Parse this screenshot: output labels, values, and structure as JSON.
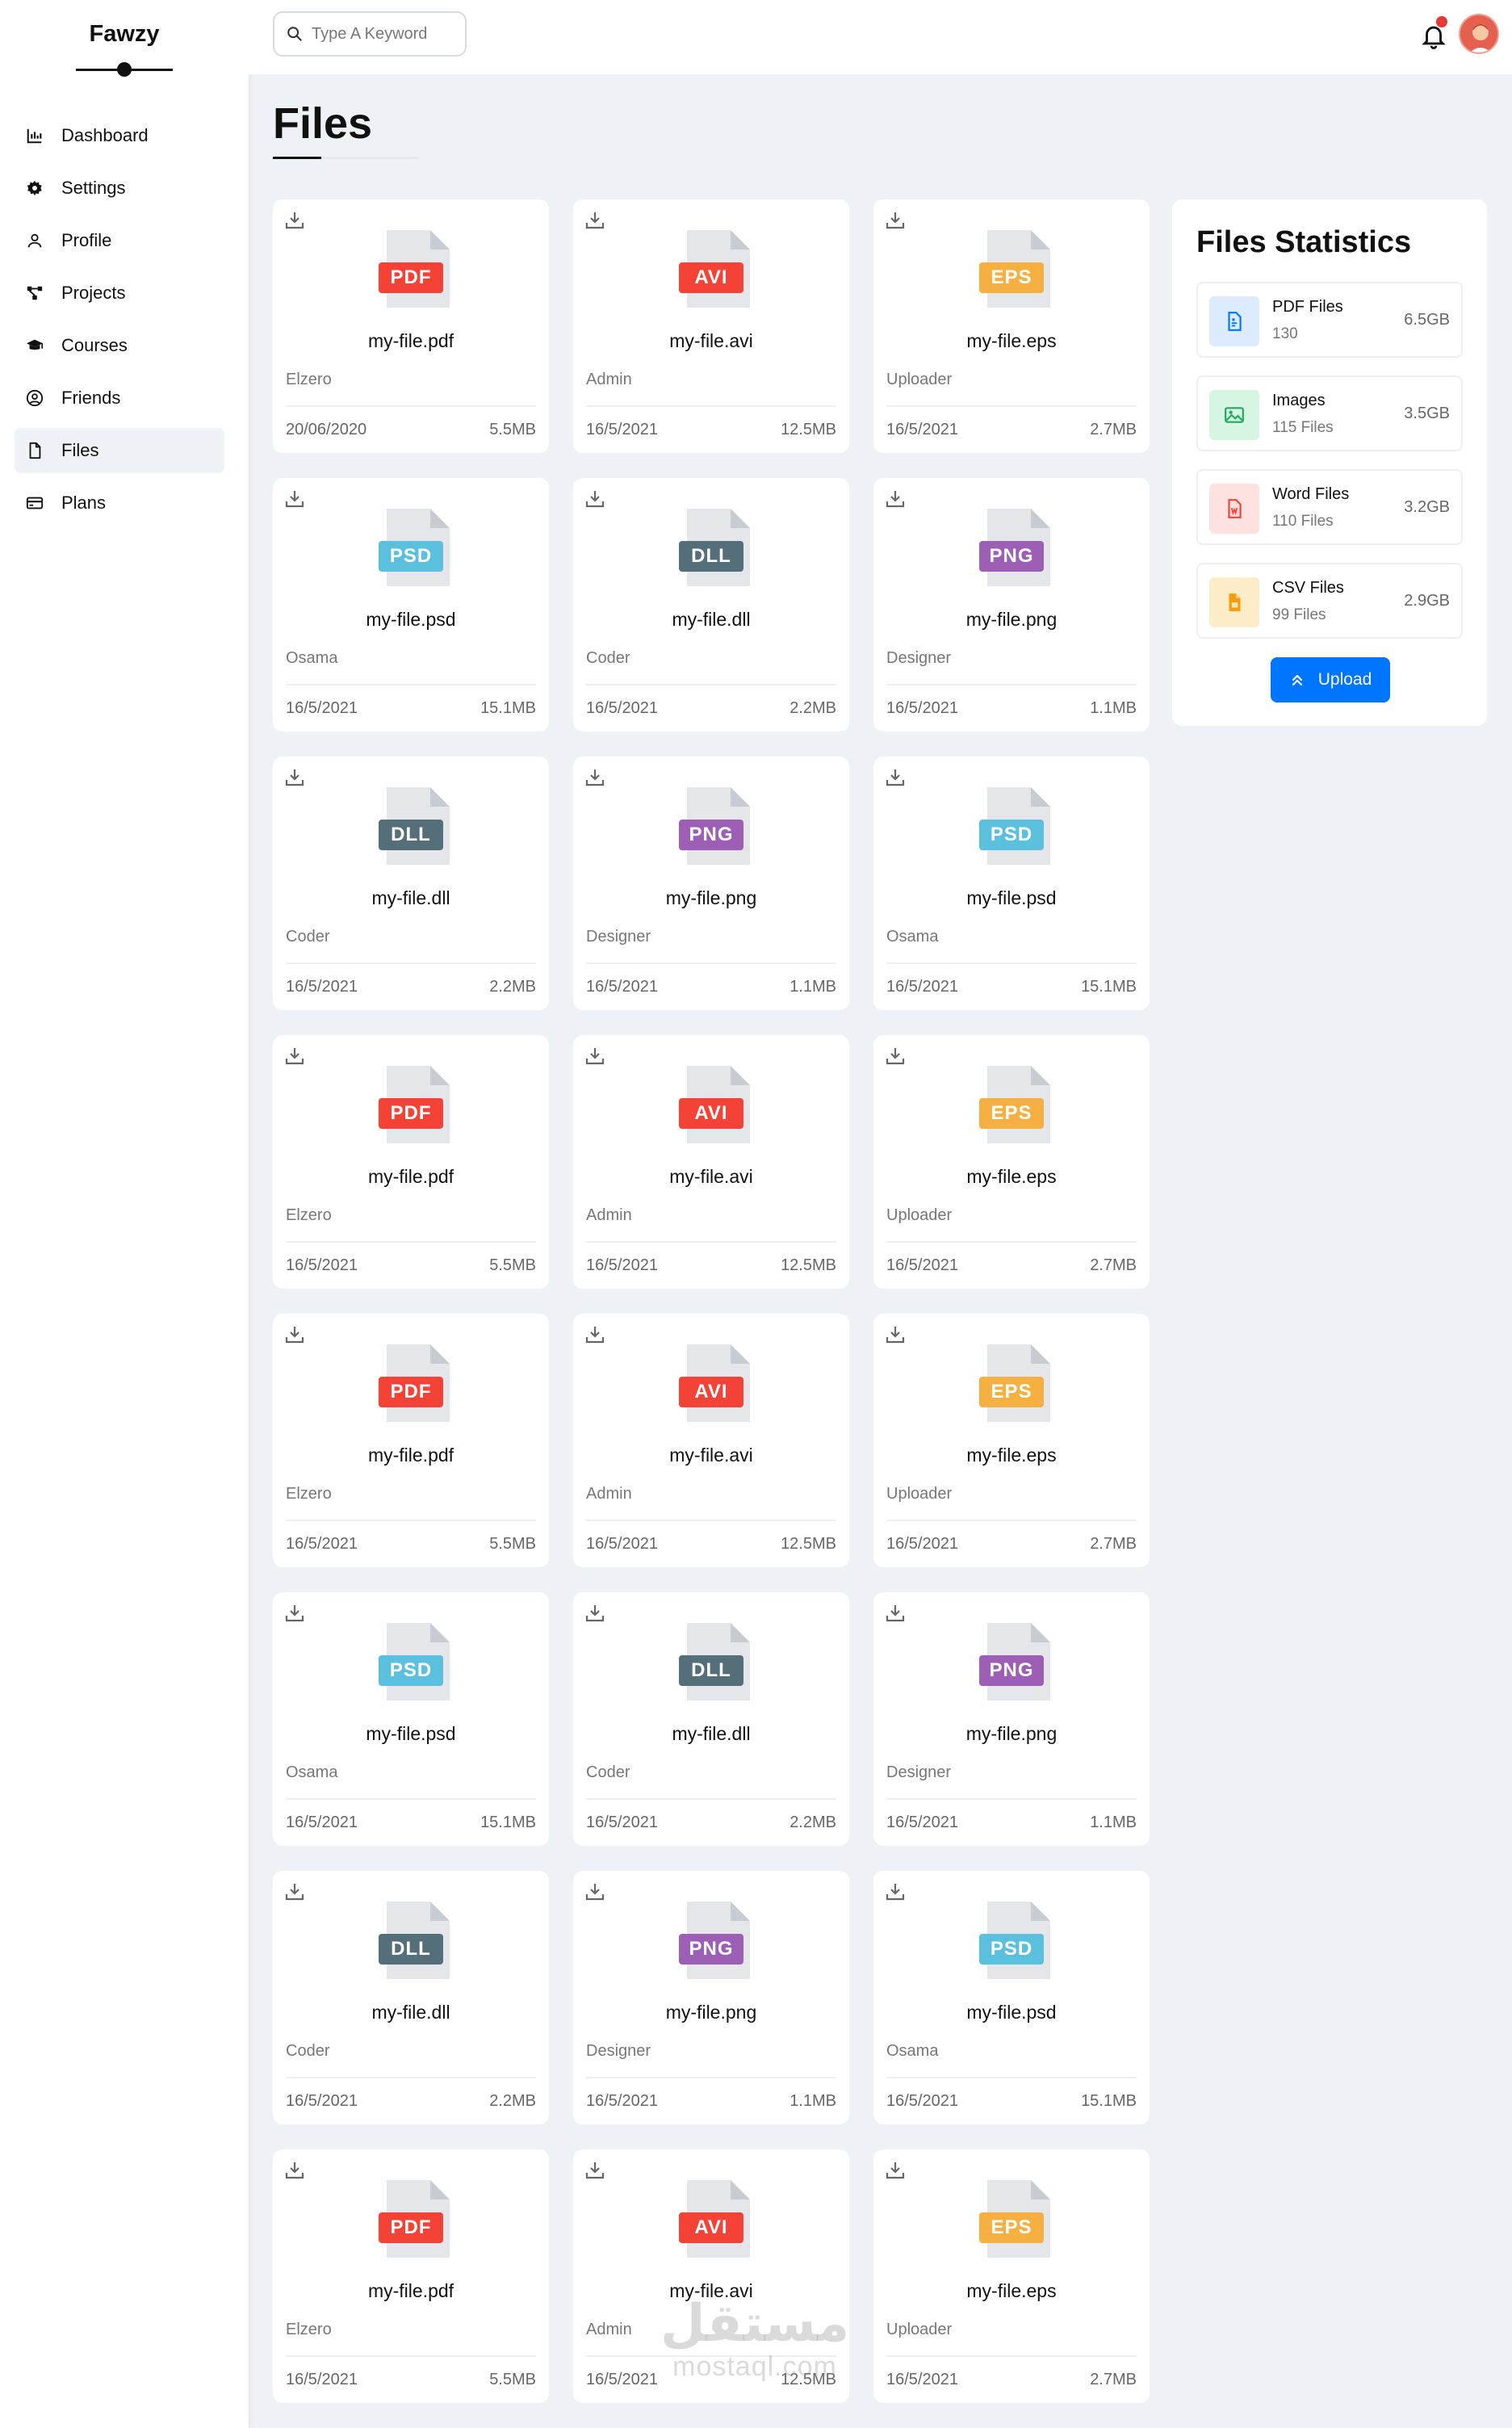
{
  "brand": "Fawzy",
  "nav": [
    {
      "label": "Dashboard",
      "icon": "chart-icon",
      "key": "dashboard"
    },
    {
      "label": "Settings",
      "icon": "gear-icon",
      "key": "settings"
    },
    {
      "label": "Profile",
      "icon": "user-icon",
      "key": "profile"
    },
    {
      "label": "Projects",
      "icon": "diagram-icon",
      "key": "projects"
    },
    {
      "label": "Courses",
      "icon": "graduation-cap-icon",
      "key": "courses"
    },
    {
      "label": "Friends",
      "icon": "user-circle-icon",
      "key": "friends"
    },
    {
      "label": "Files",
      "icon": "file-icon",
      "key": "files",
      "active": true
    },
    {
      "label": "Plans",
      "icon": "credit-card-icon",
      "key": "plans"
    }
  ],
  "search": {
    "placeholder": "Type A Keyword"
  },
  "page_title": "Files",
  "ext_colors": {
    "PDF": "#f44336",
    "AVI": "#f44336",
    "EPS": "#f5b041",
    "PSD": "#5bc0de",
    "DLL": "#546e7a",
    "PNG": "#9c5fb5"
  },
  "files": [
    {
      "ext": "PDF",
      "name": "my-file.pdf",
      "uploader": "Elzero",
      "date": "20/06/2020",
      "size": "5.5MB"
    },
    {
      "ext": "AVI",
      "name": "my-file.avi",
      "uploader": "Admin",
      "date": "16/5/2021",
      "size": "12.5MB"
    },
    {
      "ext": "EPS",
      "name": "my-file.eps",
      "uploader": "Uploader",
      "date": "16/5/2021",
      "size": "2.7MB"
    },
    {
      "ext": "PSD",
      "name": "my-file.psd",
      "uploader": "Osama",
      "date": "16/5/2021",
      "size": "15.1MB"
    },
    {
      "ext": "DLL",
      "name": "my-file.dll",
      "uploader": "Coder",
      "date": "16/5/2021",
      "size": "2.2MB"
    },
    {
      "ext": "PNG",
      "name": "my-file.png",
      "uploader": "Designer",
      "date": "16/5/2021",
      "size": "1.1MB"
    },
    {
      "ext": "DLL",
      "name": "my-file.dll",
      "uploader": "Coder",
      "date": "16/5/2021",
      "size": "2.2MB"
    },
    {
      "ext": "PNG",
      "name": "my-file.png",
      "uploader": "Designer",
      "date": "16/5/2021",
      "size": "1.1MB"
    },
    {
      "ext": "PSD",
      "name": "my-file.psd",
      "uploader": "Osama",
      "date": "16/5/2021",
      "size": "15.1MB"
    },
    {
      "ext": "PDF",
      "name": "my-file.pdf",
      "uploader": "Elzero",
      "date": "16/5/2021",
      "size": "5.5MB"
    },
    {
      "ext": "AVI",
      "name": "my-file.avi",
      "uploader": "Admin",
      "date": "16/5/2021",
      "size": "12.5MB"
    },
    {
      "ext": "EPS",
      "name": "my-file.eps",
      "uploader": "Uploader",
      "date": "16/5/2021",
      "size": "2.7MB"
    },
    {
      "ext": "PDF",
      "name": "my-file.pdf",
      "uploader": "Elzero",
      "date": "16/5/2021",
      "size": "5.5MB"
    },
    {
      "ext": "AVI",
      "name": "my-file.avi",
      "uploader": "Admin",
      "date": "16/5/2021",
      "size": "12.5MB"
    },
    {
      "ext": "EPS",
      "name": "my-file.eps",
      "uploader": "Uploader",
      "date": "16/5/2021",
      "size": "2.7MB"
    },
    {
      "ext": "PSD",
      "name": "my-file.psd",
      "uploader": "Osama",
      "date": "16/5/2021",
      "size": "15.1MB"
    },
    {
      "ext": "DLL",
      "name": "my-file.dll",
      "uploader": "Coder",
      "date": "16/5/2021",
      "size": "2.2MB"
    },
    {
      "ext": "PNG",
      "name": "my-file.png",
      "uploader": "Designer",
      "date": "16/5/2021",
      "size": "1.1MB"
    },
    {
      "ext": "DLL",
      "name": "my-file.dll",
      "uploader": "Coder",
      "date": "16/5/2021",
      "size": "2.2MB"
    },
    {
      "ext": "PNG",
      "name": "my-file.png",
      "uploader": "Designer",
      "date": "16/5/2021",
      "size": "1.1MB"
    },
    {
      "ext": "PSD",
      "name": "my-file.psd",
      "uploader": "Osama",
      "date": "16/5/2021",
      "size": "15.1MB"
    },
    {
      "ext": "PDF",
      "name": "my-file.pdf",
      "uploader": "Elzero",
      "date": "16/5/2021",
      "size": "5.5MB"
    },
    {
      "ext": "AVI",
      "name": "my-file.avi",
      "uploader": "Admin",
      "date": "16/5/2021",
      "size": "12.5MB"
    },
    {
      "ext": "EPS",
      "name": "my-file.eps",
      "uploader": "Uploader",
      "date": "16/5/2021",
      "size": "2.7MB"
    }
  ],
  "stats": {
    "title": "Files Statistics",
    "items": [
      {
        "label": "PDF Files",
        "count": "130",
        "size": "6.5GB",
        "icon": "pdf-file-icon",
        "bg": "#dcebff",
        "fg": "#0075ff"
      },
      {
        "label": "Images",
        "count": "115 Files",
        "size": "3.5GB",
        "icon": "image-icon",
        "bg": "#d7f5e3",
        "fg": "#22a860"
      },
      {
        "label": "Word Files",
        "count": "110 Files",
        "size": "3.2GB",
        "icon": "word-file-icon",
        "bg": "#fde2e0",
        "fg": "#f44336"
      },
      {
        "label": "CSV Files",
        "count": "99 Files",
        "size": "2.9GB",
        "icon": "csv-file-icon",
        "bg": "#fdecc8",
        "fg": "#f59e0b"
      }
    ],
    "upload_label": "Upload"
  },
  "watermark": {
    "arabic": "مستقل",
    "latin": "mostaql.com"
  }
}
